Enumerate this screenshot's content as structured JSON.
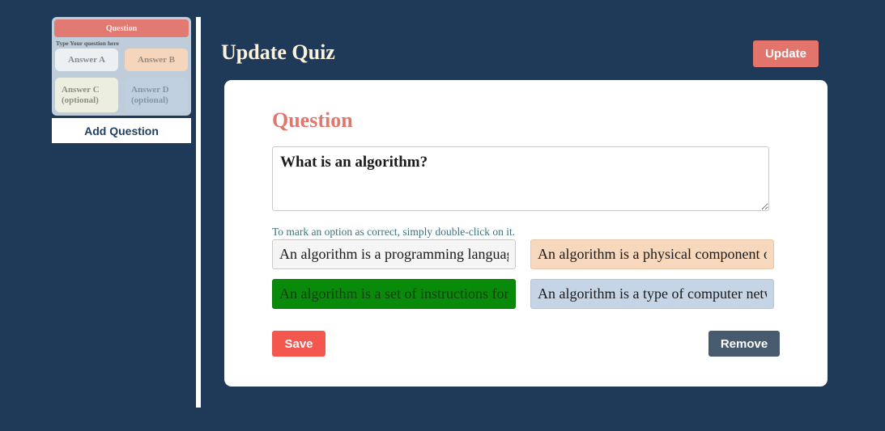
{
  "sidebar": {
    "thumbnail": {
      "heading": "Question",
      "subheading": "Type Your question here",
      "answers": [
        {
          "line1": "Answer A",
          "line2": ""
        },
        {
          "line1": "Answer B",
          "line2": ""
        },
        {
          "line1": "Answer C",
          "line2": "(optional)"
        },
        {
          "line1": "Answer D",
          "line2": "(optional)"
        }
      ]
    },
    "add_question_label": "Add Question"
  },
  "header": {
    "title": "Update Quiz",
    "update_label": "Update"
  },
  "editor": {
    "heading": "Question",
    "question_text": "What is an algorithm?",
    "hint": "To mark an option as correct, simply double-click on it.",
    "options": [
      {
        "text": "An algorithm is a programming language.",
        "color": "#f5f5f5",
        "correct": false
      },
      {
        "text": "An algorithm is a physical component of a computer.",
        "color": "#f7d8bc",
        "correct": false
      },
      {
        "text": "An algorithm is a set of instructions for solving a problem.",
        "color": "#0a8a0a",
        "correct": true
      },
      {
        "text": "An algorithm is a type of computer network.",
        "color": "#c6d5e6",
        "correct": false
      }
    ],
    "save_label": "Save",
    "remove_label": "Remove"
  },
  "colors": {
    "background": "#1e3a58",
    "accent": "#e2746b",
    "save": "#f3574e",
    "remove": "#475a6e",
    "correct": "#0a8a0a"
  }
}
